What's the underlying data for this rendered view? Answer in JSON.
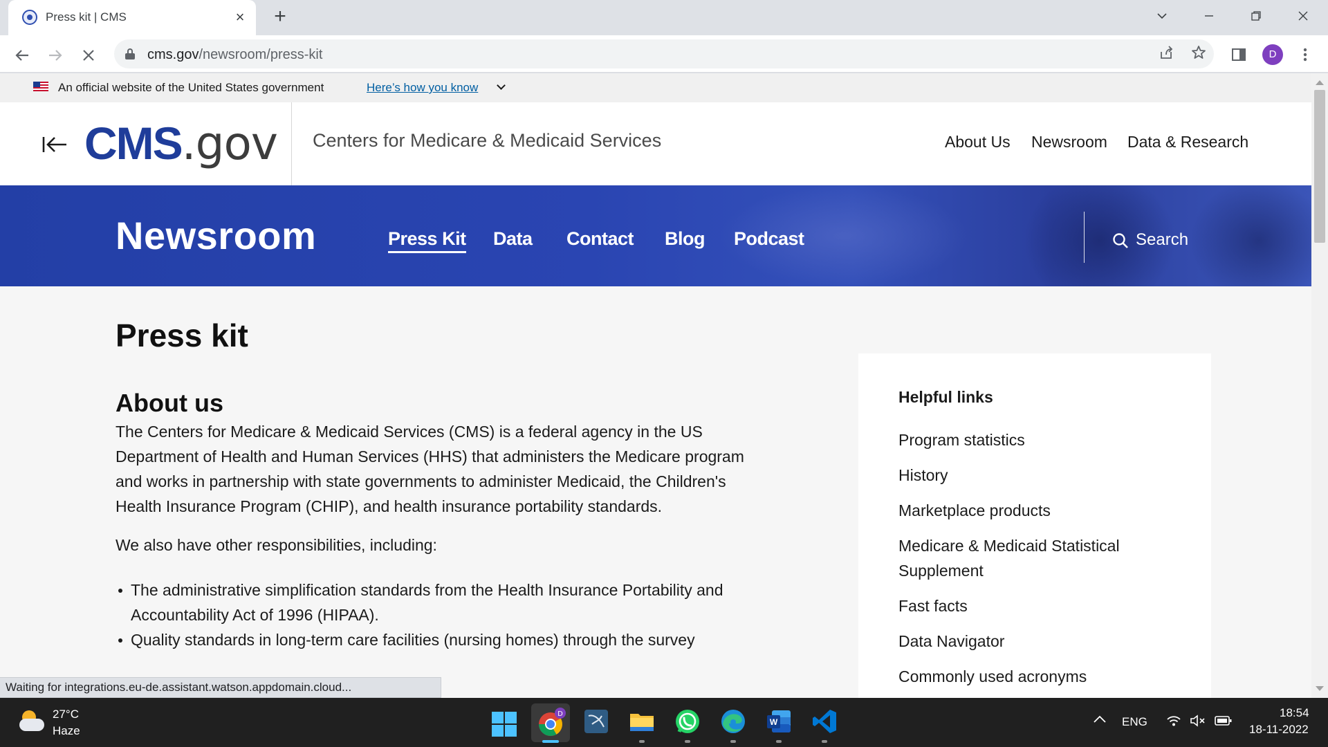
{
  "browser": {
    "tab_title": "Press kit | CMS",
    "url_domain": "cms.gov",
    "url_path": "/newsroom/press-kit",
    "profile_initial": "D",
    "status_text": "Waiting for integrations.eu-de.assistant.watson.appdomain.cloud..."
  },
  "gov_banner": {
    "text": "An official website of the United States government",
    "link": "Here’s how you know"
  },
  "header": {
    "logo_cms": "CMS",
    "logo_gov": ".gov",
    "agency": "Centers for Medicare & Medicaid Services",
    "nav": [
      "About Us",
      "Newsroom",
      "Data & Research"
    ]
  },
  "newsroom": {
    "title": "Newsroom",
    "nav": [
      "Press Kit",
      "Data",
      "Contact",
      "Blog",
      "Podcast"
    ],
    "active": "Press Kit",
    "search_label": "Search"
  },
  "content": {
    "page_title": "Press kit",
    "section_title": "About us",
    "paragraph1": "The Centers for Medicare & Medicaid Services (CMS) is a federal agency in the US Department of Health and Human Services (HHS) that administers the Medicare program and works in partnership with state governments to administer Medicaid, the Children's Health Insurance Program (CHIP), and health insurance portability standards.",
    "paragraph2": "We also have other responsibilities, including:",
    "bullets": [
      "The administrative simplification standards from the Health Insurance Portability and Accountability Act of 1996 (HIPAA).",
      "Quality standards in long-term care facilities (nursing homes) through the survey"
    ]
  },
  "helpful_links": {
    "title": "Helpful links",
    "items": [
      "Program statistics",
      "History",
      "Marketplace products",
      "Medicare & Medicaid Statistical Supplement",
      "Fast facts",
      "Data Navigator",
      "Commonly used acronyms"
    ]
  },
  "taskbar": {
    "temperature": "27°C",
    "weather": "Haze",
    "language": "ENG",
    "time": "18:54",
    "date": "18-11-2022"
  },
  "colors": {
    "brand_blue": "#1f3d9a",
    "newsroom_bar": "#2a45b2",
    "link_blue": "#005ea2"
  }
}
